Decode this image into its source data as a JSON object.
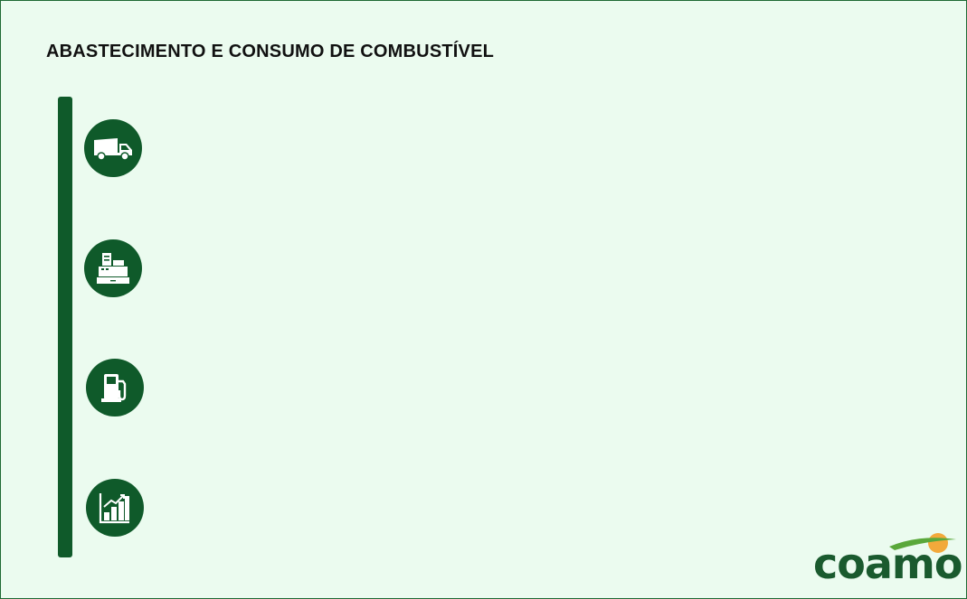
{
  "page": {
    "title": "ABASTECIMENTO E CONSUMO DE COMBUSTÍVEL"
  },
  "steps": [
    {
      "icon": "truck-icon"
    },
    {
      "icon": "cash-register-icon"
    },
    {
      "icon": "fuel-pump-icon"
    },
    {
      "icon": "growth-chart-icon"
    }
  ],
  "logo": {
    "text": "coamo",
    "colors": {
      "text": "#1a5a2e",
      "sun": "#f2a93b",
      "swoosh": "#5aa83a"
    }
  },
  "colors": {
    "background": "#ebfbef",
    "accent": "#0f5a2a"
  }
}
